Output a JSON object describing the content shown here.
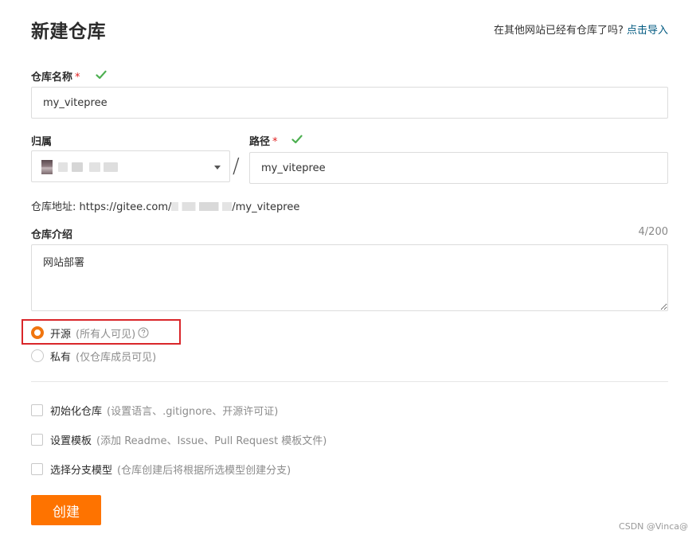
{
  "header": {
    "title": "新建仓库",
    "import_hint": "在其他网站已经有仓库了吗?",
    "import_link": "点击导入"
  },
  "form": {
    "repo_name": {
      "label": "仓库名称",
      "required_mark": "*",
      "value": "my_vitepree"
    },
    "owner": {
      "label": "归属"
    },
    "path": {
      "label": "路径",
      "required_mark": "*",
      "value": "my_vitepree",
      "separator": "/"
    },
    "repo_url": {
      "label": "仓库地址:",
      "prefix": "https://gitee.com/",
      "suffix": "/my_vitepree"
    },
    "description": {
      "label": "仓库介绍",
      "counter": "4/200",
      "value": "网站部署"
    },
    "visibility": {
      "options": [
        {
          "label": "开源",
          "note": "(所有人可见)",
          "selected": true
        },
        {
          "label": "私有",
          "note": "(仅仓库成员可见)",
          "selected": false
        }
      ]
    },
    "init_options": [
      {
        "label": "初始化仓库",
        "note": "(设置语言、.gitignore、开源许可证)"
      },
      {
        "label": "设置模板",
        "note": "(添加 Readme、Issue、Pull Request 模板文件)"
      },
      {
        "label": "选择分支模型",
        "note": "(仓库创建后将根据所选模型创建分支)"
      }
    ],
    "submit_label": "创建"
  },
  "watermark": "CSDN @Vinca@",
  "colors": {
    "accent": "#fe7300",
    "link": "#005980",
    "valid_check": "#4caf50",
    "required": "#e02020",
    "highlight_border": "#d9262a"
  }
}
